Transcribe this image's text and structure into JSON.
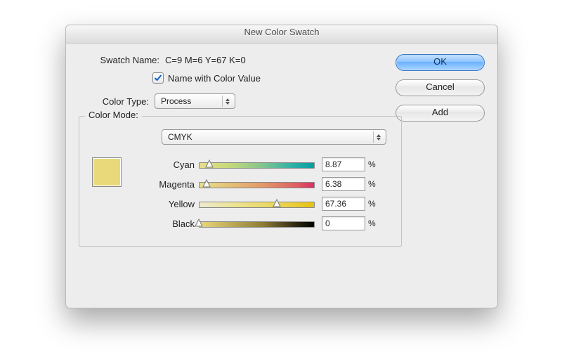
{
  "dialog": {
    "title": "New Color Swatch"
  },
  "form": {
    "swatch_name_label": "Swatch Name:",
    "swatch_name_value": "C=9 M=6 Y=67 K=0",
    "name_with_value_label": "Name with Color Value",
    "name_with_value_checked": true,
    "color_type_label": "Color Type:",
    "color_type_value": "Process"
  },
  "mode": {
    "legend": "Color Mode:",
    "value": "CMYK"
  },
  "channels": {
    "cyan": {
      "label": "Cyan",
      "value": "8.87",
      "unit": "%"
    },
    "magenta": {
      "label": "Magenta",
      "value": "6.38",
      "unit": "%"
    },
    "yellow": {
      "label": "Yellow",
      "value": "67.36",
      "unit": "%"
    },
    "black": {
      "label": "Black",
      "value": "0",
      "unit": "%"
    }
  },
  "preview_color": "#ead97a",
  "buttons": {
    "ok": "OK",
    "cancel": "Cancel",
    "add": "Add"
  }
}
